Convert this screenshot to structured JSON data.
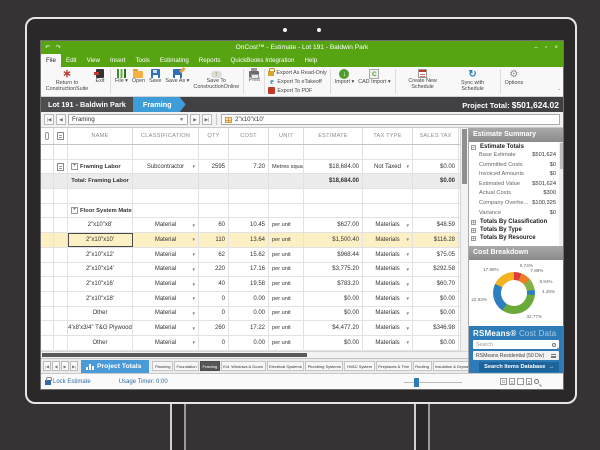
{
  "window": {
    "title": "OnCost™ - Estimate - Lot 191 - Baldwin Park",
    "controls": {
      "minimize": "–",
      "maximize": "▫",
      "close": "×"
    }
  },
  "menu": {
    "tabs": [
      "File",
      "Edit",
      "View",
      "Insert",
      "Tools",
      "Estimating",
      "Reports",
      "QuickBooks Integration",
      "Help"
    ],
    "active": "File"
  },
  "ribbon": {
    "groups": [
      {
        "buttons": [
          {
            "label": "Return to ConstructionSuite",
            "icon": "construction-suite-icon",
            "cls": "i-construction",
            "glyph": "∗"
          },
          {
            "label": "Exit",
            "icon": "exit-icon",
            "cls": "i-exit"
          }
        ]
      },
      {
        "buttons": [
          {
            "label": "File",
            "icon": "file-chart-icon",
            "cls": "i-filechart",
            "caret": true
          },
          {
            "label": "Open",
            "icon": "open-folder-icon",
            "cls": "i-open"
          },
          {
            "label": "Save",
            "icon": "save-icon",
            "cls": "i-save"
          },
          {
            "label": "Save As",
            "icon": "save-as-icon",
            "cls": "i-saveas",
            "caret": true
          },
          {
            "label": "Save To ConstructionOnline",
            "icon": "cloud-upload-icon",
            "cls": "i-cloud"
          }
        ]
      },
      {
        "buttons": [
          {
            "label": "Print",
            "icon": "print-icon",
            "cls": "i-print"
          }
        ]
      },
      {
        "stack": [
          {
            "label": "Export As Read-Only",
            "icon": "lock-icon",
            "cls": "i-lock"
          },
          {
            "label": "Export To eTakeoff",
            "icon": "etakeoff-icon",
            "cls": "i-etakeoff",
            "glyph": "e"
          },
          {
            "label": "Export To PDF",
            "icon": "pdf-icon",
            "cls": "i-pdf"
          }
        ]
      },
      {
        "buttons": [
          {
            "label": "Import",
            "icon": "import-icon",
            "cls": "i-import",
            "glyph": "↓",
            "caret": true
          },
          {
            "label": "CAD Import",
            "icon": "cad-import-icon",
            "cls": "i-cad",
            "glyph": "C",
            "caret": true
          }
        ]
      },
      {
        "buttons": [
          {
            "label": "Create New Schedule",
            "icon": "new-schedule-icon",
            "cls": "i-newsched"
          },
          {
            "label": "Sync with Schedule",
            "icon": "sync-icon",
            "cls": "i-sync",
            "glyph": "↻"
          }
        ]
      },
      {
        "buttons": [
          {
            "label": "Options",
            "icon": "options-gear-icon",
            "cls": "i-gear",
            "glyph": "⚙"
          }
        ]
      }
    ]
  },
  "breadcrumb": {
    "project": "Lot 191 - Baldwin Park",
    "sheet": "Framing",
    "total_label": "Project Total:",
    "total_value": "$501,624.02"
  },
  "toolbar": {
    "sheet_selector_value": "Framing",
    "cell_value": "2\"x10\"x10'"
  },
  "table": {
    "columns": [
      "NAME",
      "CLASSIFICATION",
      "QTY",
      "COST",
      "UNIT",
      "ESTIMATE",
      "TAX TYPE",
      "SALES TAX"
    ],
    "rows": [
      {
        "type": "empty"
      },
      {
        "type": "item",
        "note": true,
        "expand": true,
        "bold": true,
        "name": "Framing Labor",
        "classification": "Subcontractor",
        "qty": "2595",
        "cost": "7.20",
        "unit": "Metres squared",
        "estimate": "$18,684.00",
        "tax_type": "Not Taxed",
        "sales_tax": "$0.00"
      },
      {
        "type": "total",
        "name": "Total: Framing Labor",
        "estimate": "$18,684.00",
        "sales_tax": "$0.00"
      },
      {
        "type": "empty"
      },
      {
        "type": "group",
        "expand": true,
        "name": "Floor System Materials"
      },
      {
        "type": "item",
        "name": "2\"x10\"x8'",
        "classification": "Material",
        "qty": "60",
        "cost": "10.45",
        "unit": "per unit",
        "estimate": "$627.00",
        "tax_type": "Materials",
        "sales_tax": "$48.59"
      },
      {
        "type": "item",
        "selected": true,
        "name": "2\"x10\"x10'",
        "classification": "Material",
        "qty": "110",
        "cost": "13.64",
        "unit": "per unit",
        "estimate": "$1,500.40",
        "tax_type": "Materials",
        "sales_tax": "$116.28"
      },
      {
        "type": "item",
        "name": "2\"x10\"x12'",
        "classification": "Material",
        "qty": "62",
        "cost": "15.62",
        "unit": "per unit",
        "estimate": "$968.44",
        "tax_type": "Materials",
        "sales_tax": "$75.05"
      },
      {
        "type": "item",
        "name": "2\"x10\"x14'",
        "classification": "Material",
        "qty": "220",
        "cost": "17.16",
        "unit": "per unit",
        "estimate": "$3,775.20",
        "tax_type": "Materials",
        "sales_tax": "$292.58"
      },
      {
        "type": "item",
        "name": "2\"x10\"x16'",
        "classification": "Material",
        "qty": "40",
        "cost": "19.58",
        "unit": "per unit",
        "estimate": "$783.20",
        "tax_type": "Materials",
        "sales_tax": "$60.70"
      },
      {
        "type": "item",
        "name": "2\"x10\"x18'",
        "classification": "Material",
        "qty": "0",
        "cost": "0.00",
        "unit": "per unit",
        "estimate": "$0.00",
        "tax_type": "Materials",
        "sales_tax": "$0.00"
      },
      {
        "type": "item",
        "name": "Other",
        "classification": "Material",
        "qty": "0",
        "cost": "0.00",
        "unit": "per unit",
        "estimate": "$0.00",
        "tax_type": "Materials",
        "sales_tax": "$0.00"
      },
      {
        "type": "item",
        "name": "4'x8'x3/4\" T&G Plywood",
        "classification": "Material",
        "qty": "260",
        "cost": "17.22",
        "unit": "per unit",
        "estimate": "$4,477.20",
        "tax_type": "Materials",
        "sales_tax": "$346.98"
      },
      {
        "type": "item",
        "name": "Other",
        "classification": "Material",
        "qty": "0",
        "cost": "0.00",
        "unit": "per unit",
        "estimate": "$0.00",
        "tax_type": "Materials",
        "sales_tax": "$0.00"
      }
    ]
  },
  "sidebar": {
    "summary_header": "Estimate Summary",
    "sections": [
      {
        "label": "Estimate Totals",
        "expanded": true
      },
      {
        "label": "Totals By Classification",
        "expanded": false
      },
      {
        "label": "Totals By Type",
        "expanded": false
      },
      {
        "label": "Totals By Resource",
        "expanded": false
      }
    ],
    "totals": [
      {
        "label": "Base Estimate",
        "value": "$501,624"
      },
      {
        "label": "Committed Costs",
        "value": "$0"
      },
      {
        "label": "Invoiced Amounts",
        "value": "$0"
      },
      {
        "label": "Estimated Value",
        "value": "$501,624"
      },
      {
        "label": "Actual Costs",
        "value": "$300"
      },
      {
        "label": "Company Overhe...",
        "value": "$100,325"
      },
      {
        "label": "Variance",
        "value": "$0"
      }
    ],
    "breakdown_header": "Cost Breakdown"
  },
  "chart_data": {
    "type": "pie",
    "title": "Cost Breakdown",
    "donut": true,
    "legend_position": "outside-labels",
    "series": [
      {
        "label": "5.74%",
        "value": 5.74,
        "color": "#db3b3b"
      },
      {
        "label": "7.88%",
        "value": 7.88,
        "color": "#ef7d23"
      },
      {
        "label": "8.94%",
        "value": 8.94,
        "color": "#85b043"
      },
      {
        "label": "4.25%",
        "value": 4.25,
        "color": "#2e7fc2"
      },
      {
        "label": "32.77%",
        "value": 32.77,
        "color": "#6aaa39"
      },
      {
        "label": "22.93%",
        "value": 22.93,
        "color": "#2e7fc2"
      },
      {
        "label": "17.89%",
        "value": 17.89,
        "color": "#f2b31f"
      }
    ]
  },
  "rsmeans": {
    "brand": "RSMeans®",
    "suffix": " Cost Data",
    "search_placeholder": "Search",
    "dropdown_value": "RSMeans Residential (50 Div)",
    "button_label": "Search Items Database",
    "button_arrow": "→"
  },
  "bottom_tabs": {
    "project_tab": "Project Totals",
    "tabs": [
      {
        "label": "Planning"
      },
      {
        "label": "Foundation"
      },
      {
        "label": "Framing",
        "active": true
      },
      {
        "label": "Ext. Windows & Doors"
      },
      {
        "label": "Electrical Systems"
      },
      {
        "label": "Plumbing Systems"
      },
      {
        "label": "HVAC System"
      },
      {
        "label": "Fireplaces & Trim"
      },
      {
        "label": "Roofing"
      },
      {
        "label": "Insulation & Drywall"
      },
      {
        "label": "D"
      }
    ]
  },
  "status_bar": {
    "lock_label": "Lock Estimate",
    "usage_label": "Usage Timer: 0:00"
  }
}
